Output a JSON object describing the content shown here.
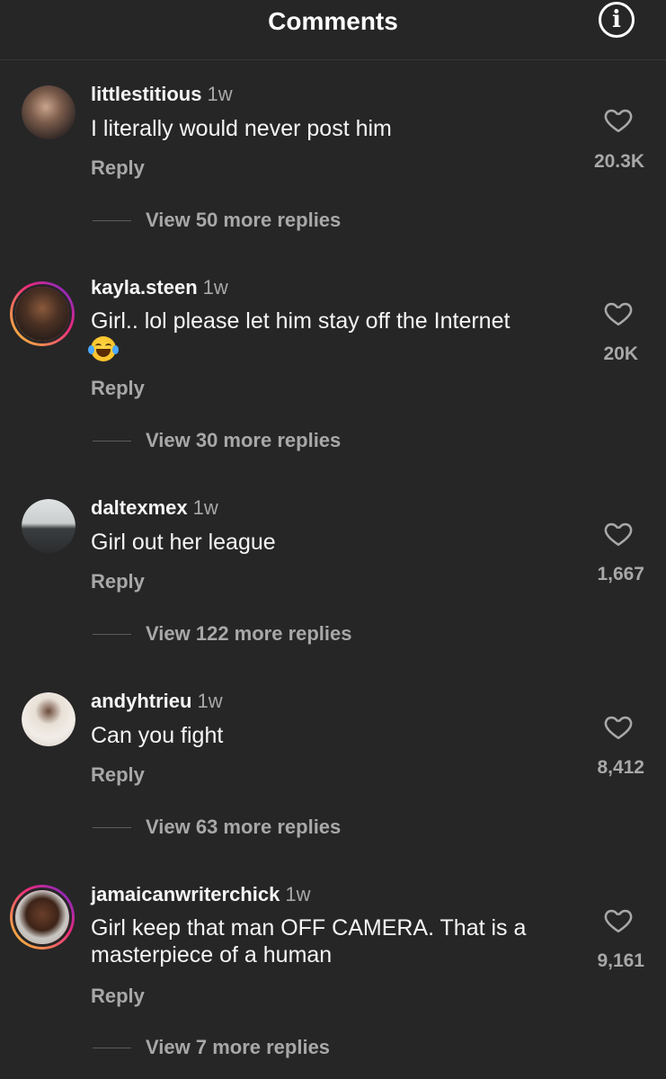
{
  "header": {
    "title": "Comments",
    "info_icon": "i"
  },
  "reply_label": "Reply",
  "comments": [
    {
      "username": "littlestitious",
      "time": "1w",
      "text": "I literally would never post him",
      "likes": "20.3K",
      "view_replies": "View 50 more replies",
      "story_ring": false
    },
    {
      "username": "kayla.steen",
      "time": "1w",
      "text": "Girl.. lol please let him stay off the Internet",
      "emoji": "face-with-tears-of-joy-emoji",
      "likes": "20K",
      "view_replies": "View 30 more replies",
      "story_ring": true
    },
    {
      "username": "daltexmex",
      "time": "1w",
      "text": "Girl out her league",
      "likes": "1,667",
      "view_replies": "View 122 more replies",
      "story_ring": false
    },
    {
      "username": "andyhtrieu",
      "time": "1w",
      "text": "Can you fight",
      "likes": "8,412",
      "view_replies": "View 63 more replies",
      "story_ring": false
    },
    {
      "username": "jamaicanwriterchick",
      "time": "1w",
      "text": "Girl keep that man OFF CAMERA. That is a masterpiece of a human",
      "likes": "9,161",
      "view_replies": "View 7 more replies",
      "story_ring": true
    }
  ],
  "colors": {
    "background": "#262626",
    "primary_text": "#f5f5f5",
    "secondary_text": "#a8a8a8",
    "story_ring_start": "#f9ce34",
    "story_ring_mid": "#ee2a7b",
    "story_ring_end": "#6228d7"
  }
}
